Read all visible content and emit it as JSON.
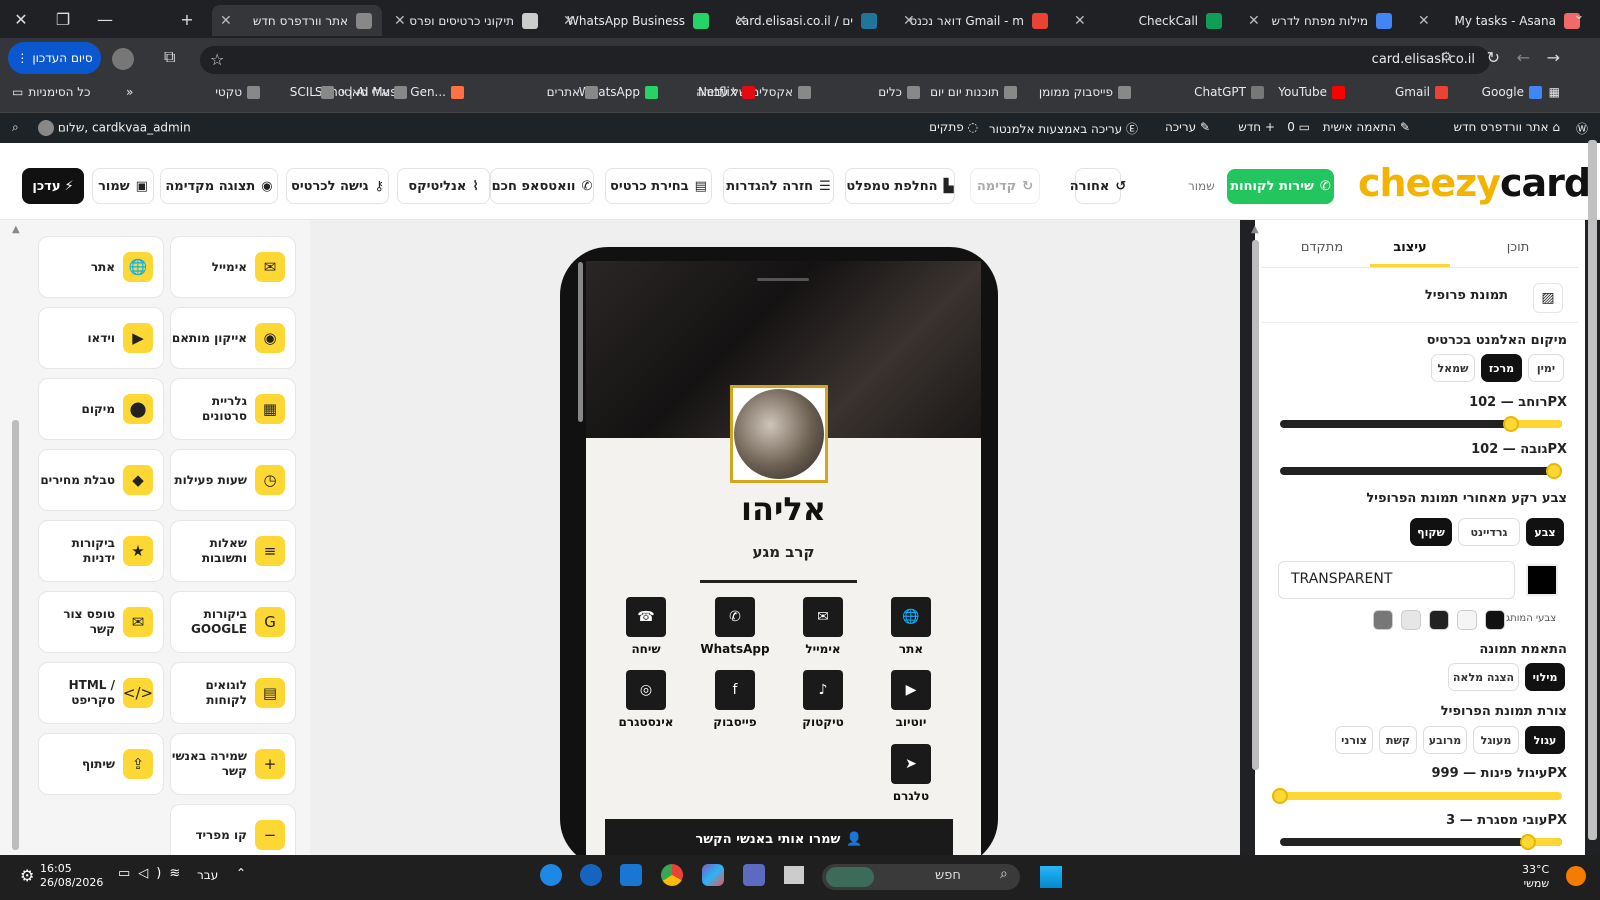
{
  "browser": {
    "tabs": [
      {
        "title": "My tasks - Asana",
        "color": "#f06a6a"
      },
      {
        "title": "מילות מפתח לדרש",
        "color": "#4285f4"
      },
      {
        "title": "CheckCall",
        "color": "#0f9d58"
      },
      {
        "title": "דואר נכנס Gmail - m",
        "color": "#ea4335"
      },
      {
        "title": "card.elisasi.co.il / ים",
        "color": "#21759b"
      },
      {
        "title": "WhatsApp Business",
        "color": "#25d366"
      },
      {
        "title": "תיקוני כרטיסים ופרס",
        "color": "#cccccc"
      },
      {
        "title": "אתר וורדפרס חדש",
        "color": "#888888"
      }
    ],
    "url": "card.elisasi.co.il",
    "finish_update": "סיום העדכון",
    "bookmarks": [
      "Google",
      "Gmail",
      "YouTube",
      "ChatGPT",
      "פייסבוק ממומן",
      "תוכנות יום יום",
      "כלים",
      "אקסלים של עבודה",
      "Netflix",
      "WhatsApp",
      "אתרים",
      "Suno | AI Music Gen...",
      "אלי סאסי",
      "SCIL",
      "טקטי"
    ],
    "all_bookmarks": "כל הסימניות"
  },
  "wpbar": {
    "site": "אתר וורדפרס חדש",
    "customize": "התאמה אישית",
    "comments": "0",
    "new": "חדש",
    "edit": "עריכה",
    "elementor": "עריכה באמצעות אלמנטור",
    "snippets": "פתקים",
    "greeting": "שלום, cardkvaa_admin"
  },
  "header": {
    "logo_part1": "cheezy",
    "logo_part2": "card",
    "support": "שירות לקוחות",
    "saved": "שמור",
    "undo": "אחורה",
    "redo": "קדימה",
    "switch_template": "החלפת טמפלט",
    "back_settings": "חזרה להגדרות",
    "choose_cards": "בחירת כרטיס",
    "smart_whatsapp": "וואטסאפ חכם",
    "analytics": "אנליטיקס",
    "card_access": "גישה לכרטיס",
    "preview": "תצוגה מקדימה",
    "save": "שמור",
    "update": "עדכן"
  },
  "widgets": [
    {
      "label": "אימייל",
      "icon": "✉"
    },
    {
      "label": "אתר",
      "icon": "🌐"
    },
    {
      "label": "אייקון מותאם",
      "icon": "◉"
    },
    {
      "label": "וידאו",
      "icon": "▶"
    },
    {
      "label": "גלריית סרטונים",
      "icon": "▦"
    },
    {
      "label": "מיקום",
      "icon": "⬤"
    },
    {
      "label": "שעות פעילות",
      "icon": "◷"
    },
    {
      "label": "טבלת מחירים",
      "icon": "◆"
    },
    {
      "label": "שאלות ותשובות",
      "icon": "≡"
    },
    {
      "label": "ביקורות ידניות",
      "icon": "★"
    },
    {
      "label": "ביקורות GOOGLE",
      "icon": "G"
    },
    {
      "label": "טופס צור קשר",
      "icon": "✉"
    },
    {
      "label": "לוגואים לקוחות",
      "icon": "▤"
    },
    {
      "label": "HTML / סקריפט",
      "icon": "</>"
    },
    {
      "label": "שמירה באנשי קשר",
      "icon": "+"
    },
    {
      "label": "שיתוף",
      "icon": "⇪"
    },
    {
      "label": "קו מפריד",
      "icon": "−"
    }
  ],
  "card": {
    "name": "אליהו",
    "title": "קרב מגע",
    "socials": [
      {
        "label": "אתר",
        "icon": "🌐"
      },
      {
        "label": "אימייל",
        "icon": "✉"
      },
      {
        "label": "WhatsApp",
        "icon": "✆"
      },
      {
        "label": "שיחה",
        "icon": "☎"
      },
      {
        "label": "יוטיוב",
        "icon": "▶"
      },
      {
        "label": "טיקטוק",
        "icon": "♪"
      },
      {
        "label": "פייסבוק",
        "icon": "f"
      },
      {
        "label": "אינסטגרם",
        "icon": "◎"
      },
      {
        "label": "טלגרם",
        "icon": "➤"
      }
    ],
    "save_contact": "שמרו אותי באנשי הקשר"
  },
  "settings": {
    "tabs": [
      "תוכן",
      "עיצוב",
      "מתקדם"
    ],
    "section_title": "תמונת פרופיל",
    "position_label": "מיקום האלמנט בכרטיס",
    "position_options": [
      "ימין",
      "מרכז",
      "שמאל"
    ],
    "width_label": "רוחב — 102PX",
    "width_value": 0.82,
    "height_label": "גובה — 102PX",
    "height_value": 0.97,
    "bg_label": "צבע רקע מאחורי תמונת הפרופיל",
    "bg_options": [
      "צבע",
      "גרדיינט",
      "שקוף"
    ],
    "bg_value": "TRANSPARENT",
    "brand_colors_label": "צבעי המותג",
    "brand_colors": [
      "#111111",
      "#f5f5f5",
      "#222222",
      "#e6e6e6",
      "#777777"
    ],
    "fit_label": "התאמת תמונה",
    "fit_options": [
      "מילוי",
      "הצגה מלאה"
    ],
    "shape_label": "צורת תמונת הפרופיל",
    "shape_options": [
      "עגול",
      "מעוגל",
      "מרובע",
      "קשת",
      "צורני"
    ],
    "radius_label": "עיגול פינות — 999PX",
    "radius_value": 0,
    "border_label": "עובי מסגרת — 3PX",
    "border_value": 0.88
  },
  "taskbar": {
    "time": "16:05",
    "date": "26/08/2026",
    "lang": "עבר",
    "search": "חפש",
    "temp": "33°C",
    "weather": "שמשי"
  }
}
